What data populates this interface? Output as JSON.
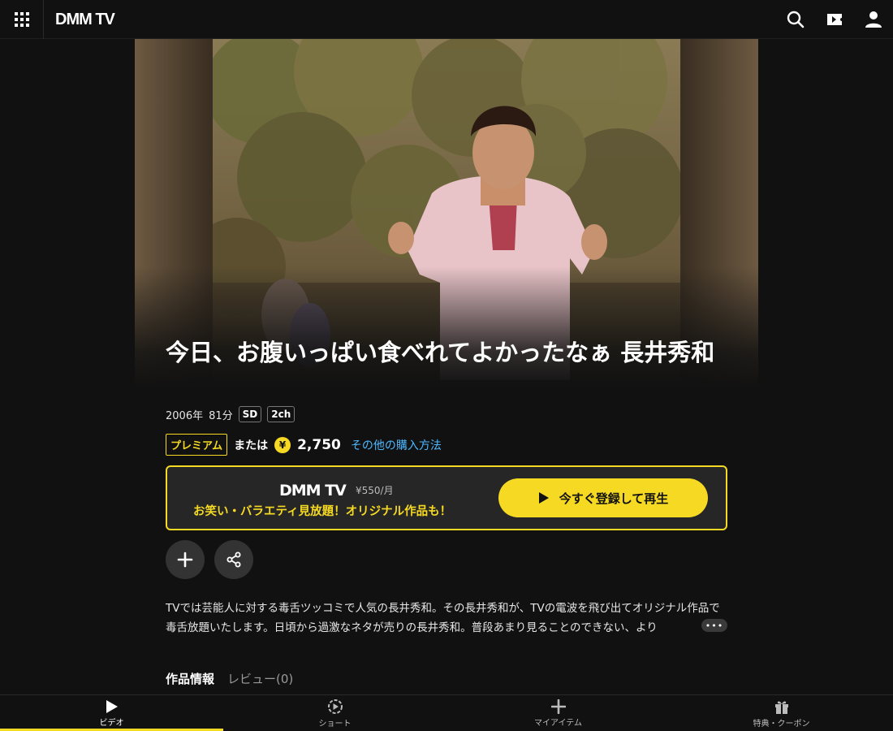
{
  "header": {
    "logo": "DMM TV",
    "icons": [
      "grid-menu-icon",
      "search-icon",
      "ticket-icon",
      "user-icon"
    ]
  },
  "content": {
    "title": "今日、お腹いっぱい食べれてよかったなぁ 長井秀和",
    "year": "2006年",
    "duration": "81分",
    "badges": [
      "SD",
      "2ch"
    ],
    "premium_label": "プレミアム",
    "or_label": "または",
    "yen_symbol": "¥",
    "price": "2,750",
    "other_purchase_link": "その他の購入方法",
    "description": "TVでは芸能人に対する毒舌ツッコミで人気の長井秀和。その長井秀和が、TVの電波を飛び出てオリジナル作品で毒舌放題いたします。日頃から過激なネタが売りの長井秀和。普段あまり見ることのできない、より",
    "more_label": "•••"
  },
  "promo": {
    "logo": "DMM TV",
    "price": "¥550/月",
    "tagline": "お笑い・バラエティ見放題！オリジナル作品も！",
    "button_label": "今すぐ登録して再生"
  },
  "tabs": [
    {
      "label": "作品情報",
      "active": true
    },
    {
      "label": "レビュー(0)",
      "active": false
    }
  ],
  "bottom_nav": [
    {
      "label": "ビデオ",
      "icon": "play-icon",
      "active": true
    },
    {
      "label": "ショート",
      "icon": "short-icon",
      "active": false
    },
    {
      "label": "マイアイテム",
      "icon": "plus-icon",
      "active": false
    },
    {
      "label": "特典・クーポン",
      "icon": "gift-icon",
      "active": false
    }
  ],
  "colors": {
    "accent": "#f5d923",
    "link": "#4db8ff",
    "background": "#111111"
  }
}
